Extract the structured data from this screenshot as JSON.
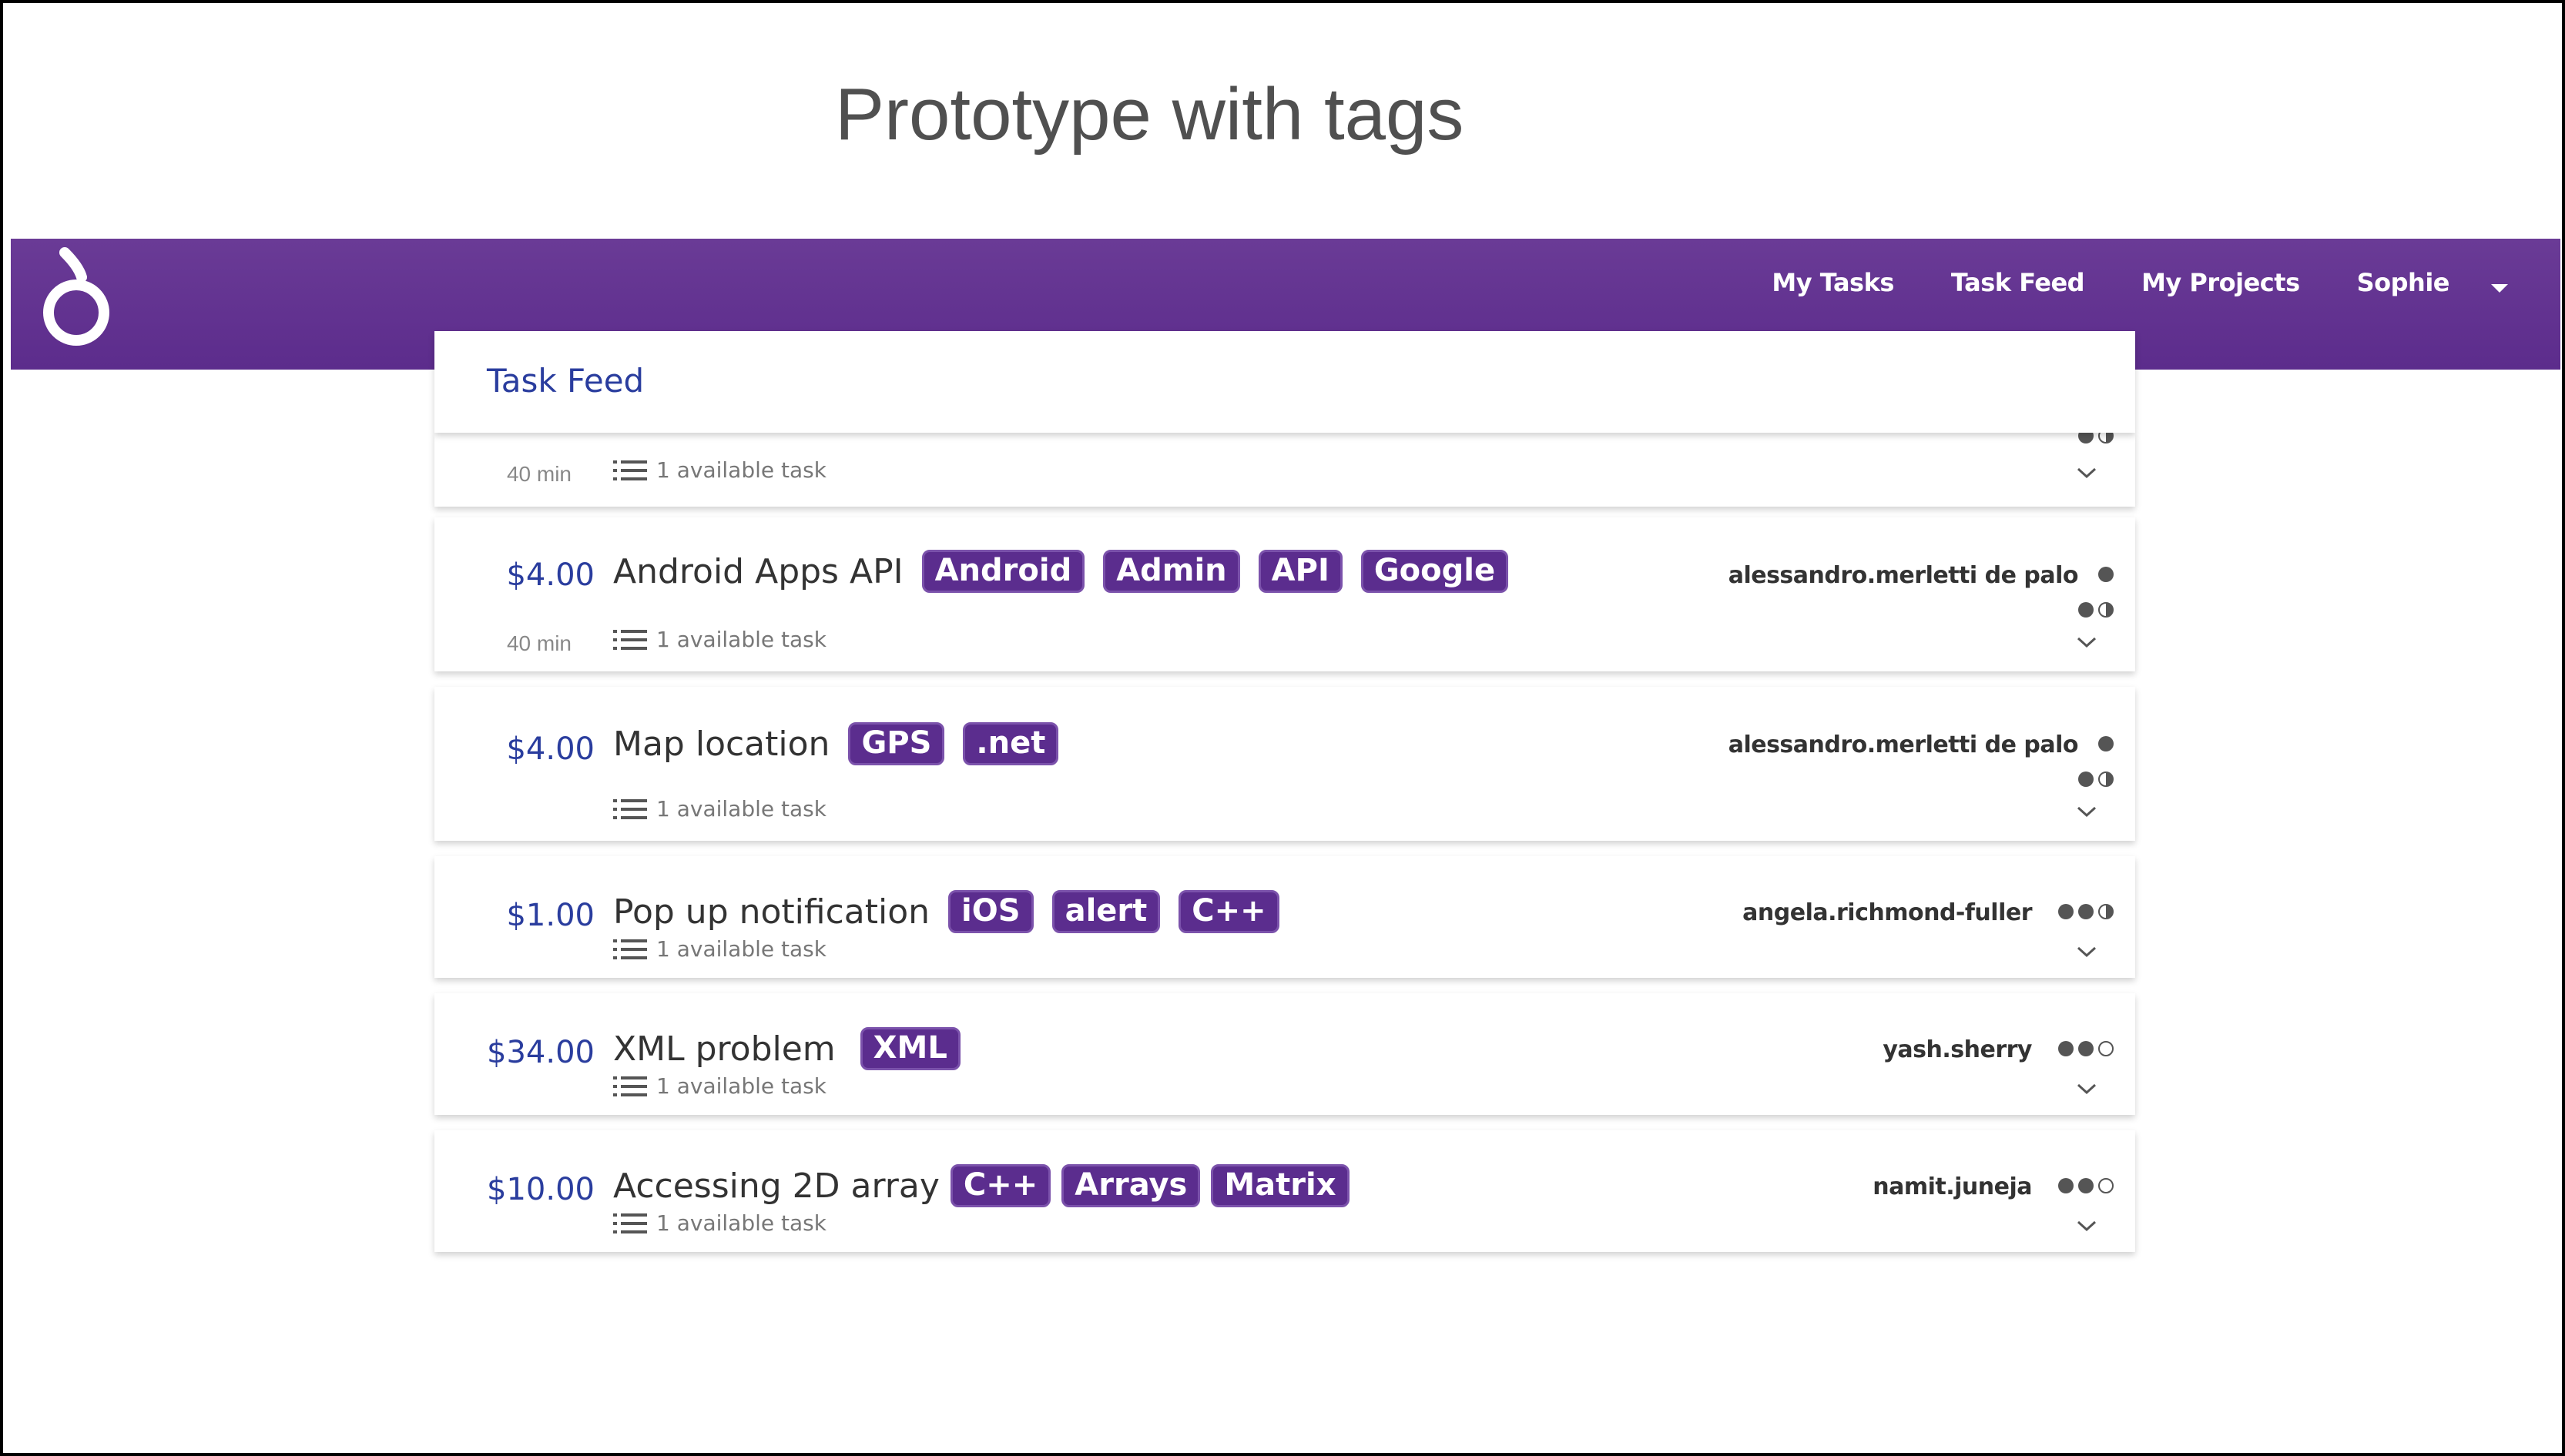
{
  "slide": {
    "title": "Prototype with tags"
  },
  "nav": {
    "links": [
      "My Tasks",
      "Task Feed",
      "My Projects",
      "Sophie"
    ],
    "logo_icon": "logo-icon",
    "caret_icon": "caret-down-icon",
    "background": "#5c2c8c"
  },
  "feed": {
    "header": "Task Feed",
    "top_partial": {
      "duration": "40 min",
      "available": "1 available task"
    },
    "tasks": [
      {
        "price": "$4.00",
        "title": "Android Apps API",
        "tags": [
          "Android",
          "Admin",
          "API",
          "Google"
        ],
        "owner": "alessandro.merletti de palo",
        "duration": "40 min",
        "available": "1 available task"
      },
      {
        "price": "$4.00",
        "title": "Map location",
        "tags": [
          "GPS",
          ".net"
        ],
        "owner": "alessandro.merletti de palo",
        "duration": "",
        "available": "1 available task"
      },
      {
        "price": "$1.00",
        "title": "Pop up notification",
        "tags": [
          "iOS",
          "alert",
          "C++"
        ],
        "owner": "angela.richmond-fuller",
        "duration": "",
        "available": "1 available task"
      },
      {
        "price": "$34.00",
        "title": "XML problem",
        "tags": [
          "XML"
        ],
        "owner": "yash.sherry",
        "duration": "",
        "available": "1 available task"
      },
      {
        "price": "$10.00",
        "title": "Accessing 2D array",
        "tags": [
          "C++",
          "Arrays",
          "Matrix"
        ],
        "owner": "namit.juneja",
        "duration": "",
        "available": "1 available task"
      }
    ]
  },
  "colors": {
    "accent": "#2a3d9e",
    "tag": "#5b2d8e"
  }
}
